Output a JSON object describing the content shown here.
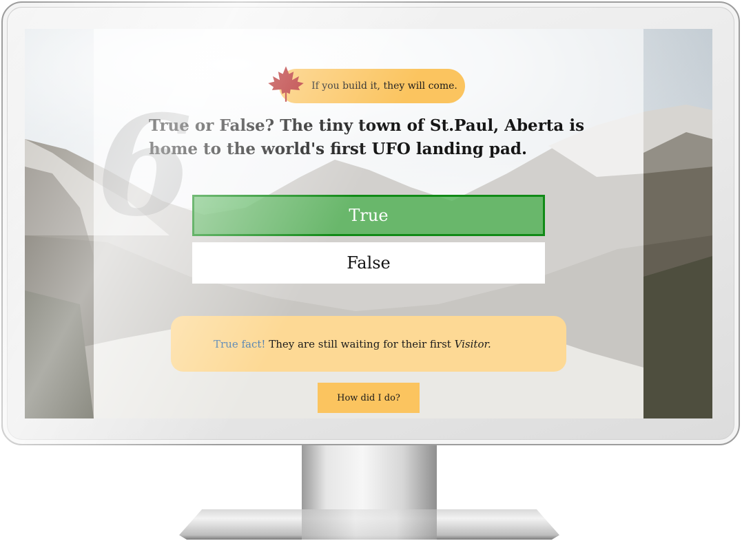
{
  "quiz": {
    "question_number": "6",
    "tagline": "If you build it, they will come.",
    "question": "True or False? The tiny town of St.Paul, Aberta is home to the world's first UFO landing pad.",
    "answers": [
      {
        "label": "True",
        "state": "selected-correct"
      },
      {
        "label": "False",
        "state": "unselected"
      }
    ],
    "feedback": {
      "label": "True fact!",
      "text": " They are still waiting for their first ",
      "emphasis": "Visitor."
    },
    "results_button": "How did I do?"
  },
  "colors": {
    "accent": "#fbc45f",
    "feedback_bg": "#fdd995",
    "correct_fill": "#4caf50",
    "correct_border": "#118a17",
    "fact_label": "#4f7fae",
    "maple_leaf": "#b22222"
  },
  "icons": {
    "tagline_icon": "maple-leaf-icon"
  }
}
